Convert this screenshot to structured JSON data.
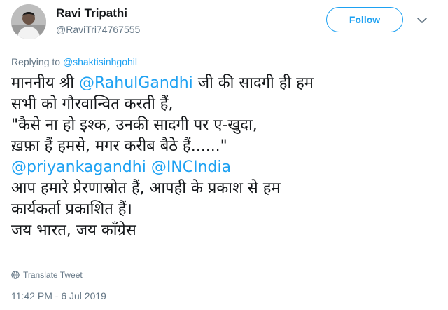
{
  "user": {
    "name": "Ravi Tripathi",
    "handle": "@RaviTri74767555"
  },
  "follow_label": "Follow",
  "replying": {
    "prefix": "Replying to",
    "mention": "@shaktisinhgohil"
  },
  "tweet": {
    "l1_a": "माननीय श्री ",
    "l1_mention": "@RahulGandhi",
    "l1_b": " जी की सादगी ही हम",
    "l2": "सभी को गौरवान्वित करती हैं,",
    "l3": "\"कैसे ना हो इश्क, उनकी सादगी पर ए-खुदा,",
    "l4": "ख़फ़ा हैं हमसे, मगर करीब बैठे हैं......\"",
    "l5_mention1": "@priyankagandhi",
    "l5_space": " ",
    "l5_mention2": "@INCIndia",
    "l6": "आप हमारे प्रेरणास्रोत हैं, आपही के प्रकाश से हम",
    "l7": "कार्यकर्ता प्रकाशित हैं।",
    "l8": "जय भारत, जय कॉंग्रेस"
  },
  "translate_label": "Translate Tweet",
  "timestamp": "11:42 PM - 6 Jul 2019",
  "colors": {
    "link": "#1da1f2",
    "muted": "#657786",
    "text": "#14171a"
  },
  "icons": {
    "menu": "chevron-down-icon",
    "translate": "globe-icon"
  }
}
